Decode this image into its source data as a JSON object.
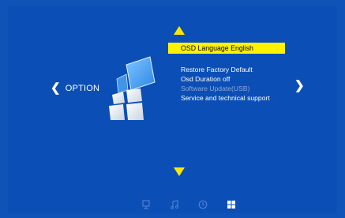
{
  "nav": {
    "left_label": "OPTION",
    "left_chevron": "❮",
    "right_chevron": "❯"
  },
  "menu": {
    "items": [
      {
        "label": "OSD Language  English",
        "state": "selected"
      },
      {
        "label": "Restore Factory Default",
        "state": "normal"
      },
      {
        "label": "Osd Duration   off",
        "state": "normal"
      },
      {
        "label": "Software   Update(USB)",
        "state": "disabled"
      },
      {
        "label": "Service and technical support",
        "state": "normal"
      }
    ]
  },
  "bottom_icons": [
    {
      "name": "monitor-icon",
      "active": false
    },
    {
      "name": "music-note-icon",
      "active": false
    },
    {
      "name": "clock-icon",
      "active": false
    },
    {
      "name": "windows-grid-icon",
      "active": true
    }
  ],
  "colors": {
    "background": "#0b4fb6",
    "highlight": "#fff200",
    "arrow": "#ffe600",
    "disabled_text": "#8fa6d6",
    "icon_inactive": "#4f7fd1",
    "icon_active": "#ffffff"
  }
}
